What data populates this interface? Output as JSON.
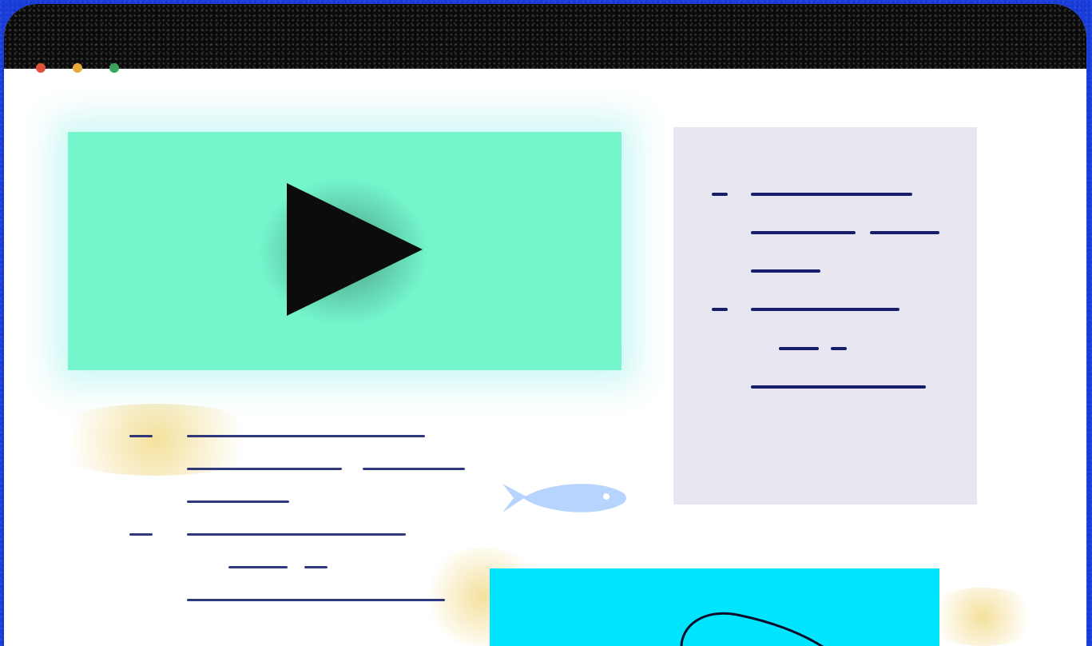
{
  "colors": {
    "background": "#1a3fe0",
    "titlebar": "#0b0b0b",
    "window": "#ffffff",
    "video_panel": "#74f5cc",
    "text_panel": "#e8e6f0",
    "text_lines": "#151f6a",
    "fish": "#b7d4ff",
    "bottom_box": "#00e5ff"
  },
  "icons": {
    "play": "play-icon",
    "fish": "fish-icon",
    "swirl": "swirl-line"
  }
}
